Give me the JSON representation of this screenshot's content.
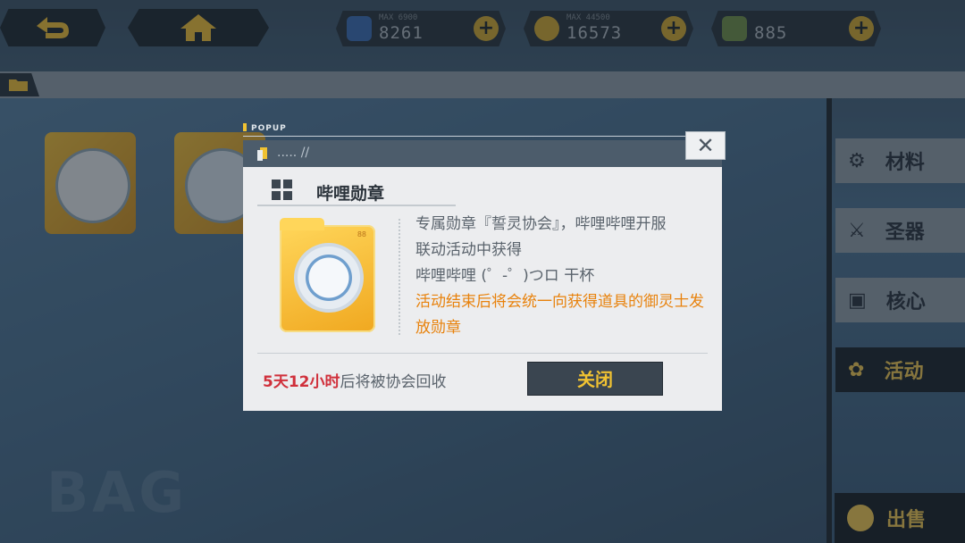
{
  "topbar": {
    "back_icon": "back-arrow-icon",
    "home_icon": "home-icon",
    "resources": [
      {
        "name": "card",
        "max": "MAX 6900",
        "value": "8261",
        "color": "#3b6bb0"
      },
      {
        "name": "gold",
        "max": "MAX 44500",
        "value": "16573",
        "color": "#c9a233"
      },
      {
        "name": "crystal",
        "max": "",
        "value": "885",
        "color": "#6c8a4a"
      }
    ]
  },
  "side_menu": [
    {
      "label": "材料",
      "icon": "gear-icon"
    },
    {
      "label": "圣器",
      "icon": "sword-icon"
    },
    {
      "label": "核心",
      "icon": "chip-icon"
    },
    {
      "label": "活动",
      "icon": "flower-icon",
      "active": true
    }
  ],
  "bag_label": "BAG",
  "sell_label": "出售",
  "popup": {
    "label": "POPUP",
    "header_text": "..... //",
    "close_icon": "close-icon",
    "title": "哔哩勋章",
    "badge_level": "88",
    "desc_lines": [
      "专属勋章『誓灵协会』，哔哩哔哩开服",
      "联动活动中获得",
      "哔哩哔哩 (゜-゜)つロ 干杯"
    ],
    "desc_orange": "活动结束后将会统一向获得道具的御灵士发放勋章",
    "timer_red": "5天12小时",
    "timer_rest": "后将被协会回收",
    "close_button": "关闭"
  },
  "colors": {
    "accent": "#f0c232",
    "orange_text": "#e8820c",
    "red_text": "#d0303b"
  }
}
